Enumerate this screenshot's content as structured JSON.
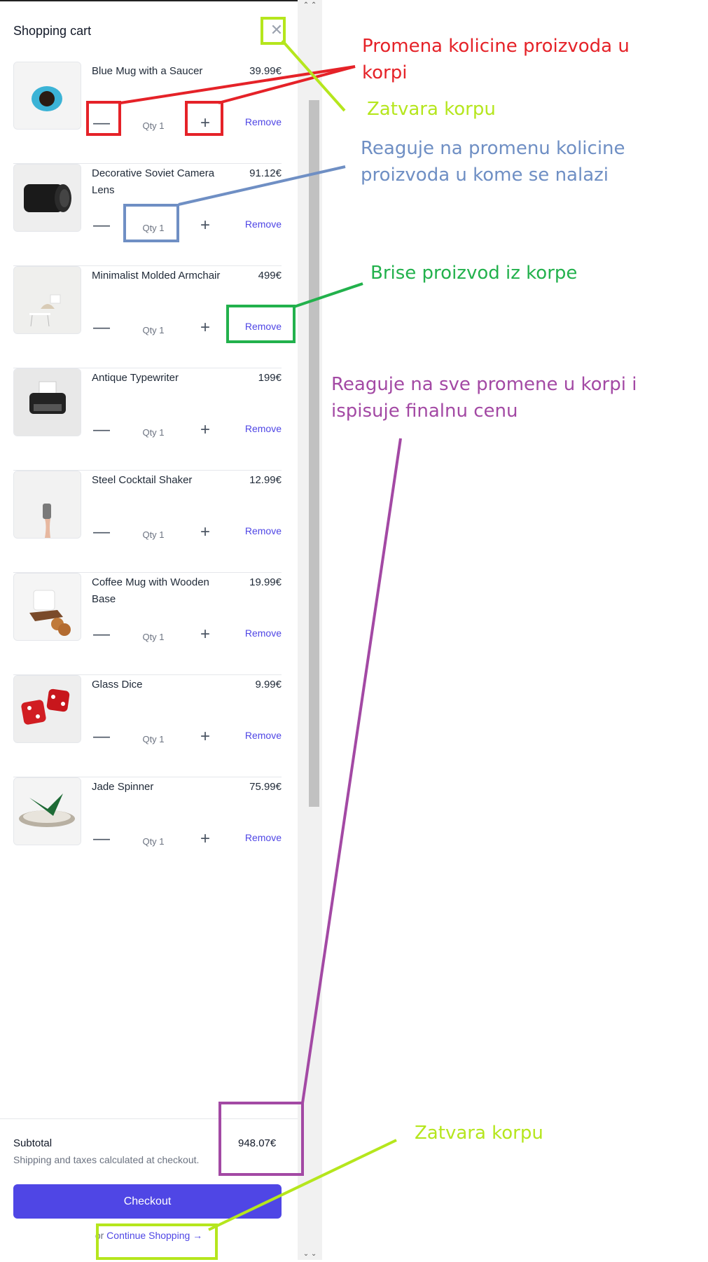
{
  "cart": {
    "title": "Shopping cart",
    "close_symbol": "✕",
    "items": [
      {
        "name": "Blue Mug with a Saucer",
        "price": "39.99€",
        "qty": "Qty 1",
        "remove": "Remove"
      },
      {
        "name": "Decorative Soviet Camera Lens",
        "price": "91.12€",
        "qty": "Qty 1",
        "remove": "Remove"
      },
      {
        "name": "Minimalist Molded Armchair",
        "price": "499€",
        "qty": "Qty 1",
        "remove": "Remove"
      },
      {
        "name": "Antique Typewriter",
        "price": "199€",
        "qty": "Qty 1",
        "remove": "Remove"
      },
      {
        "name": "Steel Cocktail Shaker",
        "price": "12.99€",
        "qty": "Qty 1",
        "remove": "Remove"
      },
      {
        "name": "Coffee Mug with Wooden Base",
        "price": "19.99€",
        "qty": "Qty 1",
        "remove": "Remove"
      },
      {
        "name": "Glass Dice",
        "price": "9.99€",
        "qty": "Qty 1",
        "remove": "Remove"
      },
      {
        "name": "Jade Spinner",
        "price": "75.99€",
        "qty": "Qty 1",
        "remove": "Remove"
      }
    ],
    "minus_symbol": "—",
    "plus_symbol": "+",
    "subtotal_label": "Subtotal",
    "subtotal_value": "948.07€",
    "shipping_note": "Shipping and taxes calculated at checkout.",
    "checkout_label": "Checkout",
    "continue_prefix": "or ",
    "continue_label": "Continue Shopping →"
  },
  "annotations": {
    "qty_change": "Promena kolicine proizvoda u korpi",
    "close_top": "Zatvara korpu",
    "line_total": "Reaguje na promenu kolicine proizvoda u kome se nalazi",
    "remove_item": "Brise proizvod iz korpe",
    "subtotal": "Reaguje na sve promene u korpi i ispisuje finalnu cenu",
    "close_bottom": "Zatvara korpu"
  },
  "colors": {
    "red": "#e52228",
    "lime": "#b5e61d",
    "blue": "#6f8fc4",
    "green": "#22b14c",
    "purple": "#a349a4",
    "accent": "#4f46e5"
  },
  "icons": [
    "close-icon",
    "minus-icon",
    "plus-icon"
  ]
}
